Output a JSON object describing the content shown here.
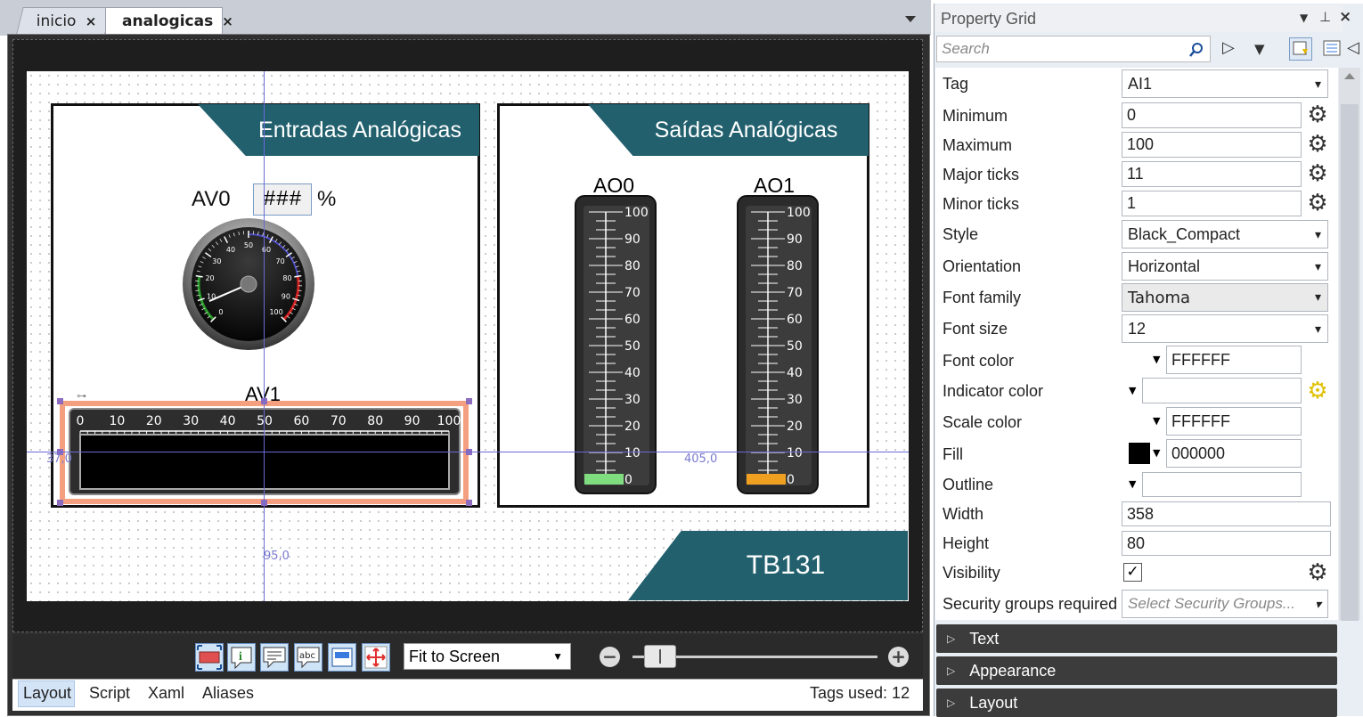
{
  "tabs": [
    {
      "label": "inicio",
      "close": "×"
    },
    {
      "label": "analogicas",
      "close": "×"
    }
  ],
  "canvas": {
    "panel_left": {
      "banner": "Entradas Analógicas",
      "av0_label": "AV0",
      "av0_value": "###",
      "av0_unit": "%",
      "gauge_ticks": [
        "0",
        "10",
        "20",
        "30",
        "40",
        "50",
        "60",
        "70",
        "80",
        "90",
        "100"
      ],
      "gauge_value": 8,
      "av1_label": "AV1",
      "hbar_ticks": [
        "0",
        "10",
        "20",
        "30",
        "40",
        "50",
        "60",
        "70",
        "80",
        "90",
        "100"
      ],
      "hbar_value": 0
    },
    "panel_right": {
      "banner": "Saídas Analógicas",
      "ao0_label": "AO0",
      "ao1_label": "AO1",
      "vbar_ticks": [
        "100",
        "90",
        "80",
        "70",
        "60",
        "50",
        "40",
        "30",
        "20",
        "10",
        "0"
      ],
      "ao0_color": "#7fdc7f",
      "ao1_color": "#f0a020"
    },
    "footer_banner": "TB131",
    "guides": {
      "x_label_left": "37,0",
      "x_label_right": "405,0",
      "y_label": "95,0"
    }
  },
  "toolbar": {
    "zoom": "Fit to Screen",
    "icons": [
      "select-area-icon",
      "info-icon",
      "comment-icon",
      "abc-icon",
      "form-icon",
      "resize-icon"
    ]
  },
  "bottom_tabs": [
    "Layout",
    "Script",
    "Xaml",
    "Aliases"
  ],
  "tags_used": "Tags used: 12",
  "property_grid": {
    "title": "Property Grid",
    "search_placeholder": "Search",
    "rows": {
      "tag": {
        "label": "Tag",
        "value": "AI1"
      },
      "minimum": {
        "label": "Minimum",
        "value": "0"
      },
      "maximum": {
        "label": "Maximum",
        "value": "100"
      },
      "major_ticks": {
        "label": "Major ticks",
        "value": "11"
      },
      "minor_ticks": {
        "label": "Minor ticks",
        "value": "1"
      },
      "style": {
        "label": "Style",
        "value": "Black_Compact"
      },
      "orientation": {
        "label": "Orientation",
        "value": "Horizontal"
      },
      "font_family": {
        "label": "Font family",
        "value": "Tahoma"
      },
      "font_size": {
        "label": "Font size",
        "value": "12"
      },
      "font_color": {
        "label": "Font color",
        "value": "FFFFFF"
      },
      "indicator_color": {
        "label": "Indicator color",
        "value": ""
      },
      "scale_color": {
        "label": "Scale color",
        "value": "FFFFFF"
      },
      "fill": {
        "label": "Fill",
        "value": "000000"
      },
      "outline": {
        "label": "Outline",
        "value": ""
      },
      "width": {
        "label": "Width",
        "value": "358"
      },
      "height": {
        "label": "Height",
        "value": "80"
      },
      "visibility": {
        "label": "Visibility",
        "checked": true
      },
      "security": {
        "label": "Security groups required",
        "placeholder": "Select Security Groups..."
      }
    },
    "categories": [
      "Text",
      "Appearance",
      "Layout"
    ]
  },
  "colors": {
    "banner": "#22606e",
    "accent_selection": "#f4a080"
  }
}
